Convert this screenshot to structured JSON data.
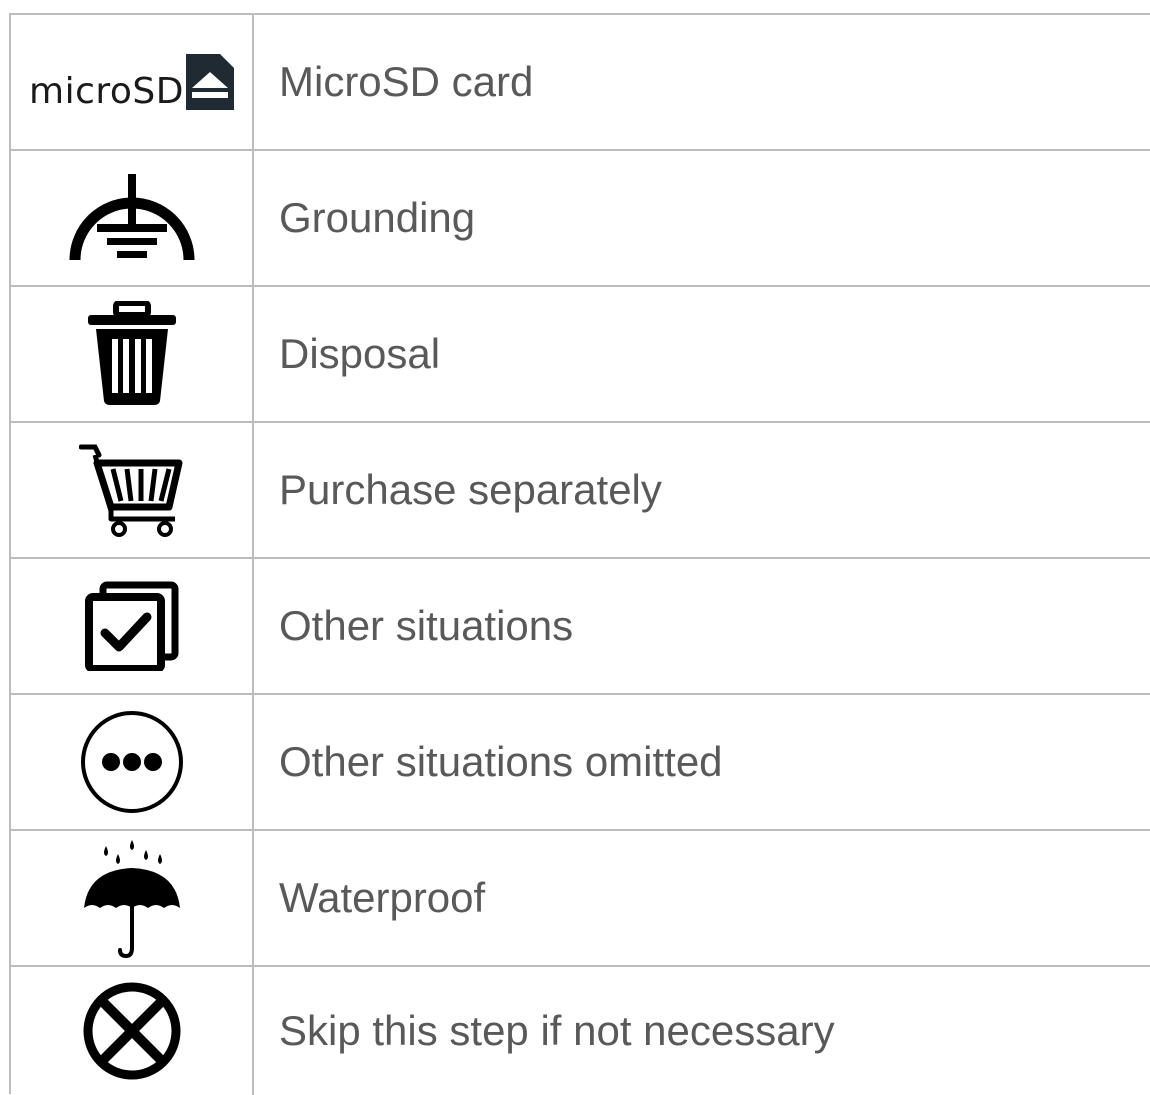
{
  "rows": [
    {
      "icon": "microsd-icon",
      "logo_text": "microSD",
      "label": "MicroSD card"
    },
    {
      "icon": "grounding-icon",
      "label": "Grounding"
    },
    {
      "icon": "trash-icon",
      "label": "Disposal"
    },
    {
      "icon": "shopping-cart-icon",
      "label": "Purchase separately"
    },
    {
      "icon": "checkbox-stack-icon",
      "label": "Other situations"
    },
    {
      "icon": "ellipsis-circle-icon",
      "label": "Other situations omitted"
    },
    {
      "icon": "umbrella-rain-icon",
      "label": "Waterproof"
    },
    {
      "icon": "circle-x-icon",
      "label": "Skip this step if not necessary"
    }
  ]
}
